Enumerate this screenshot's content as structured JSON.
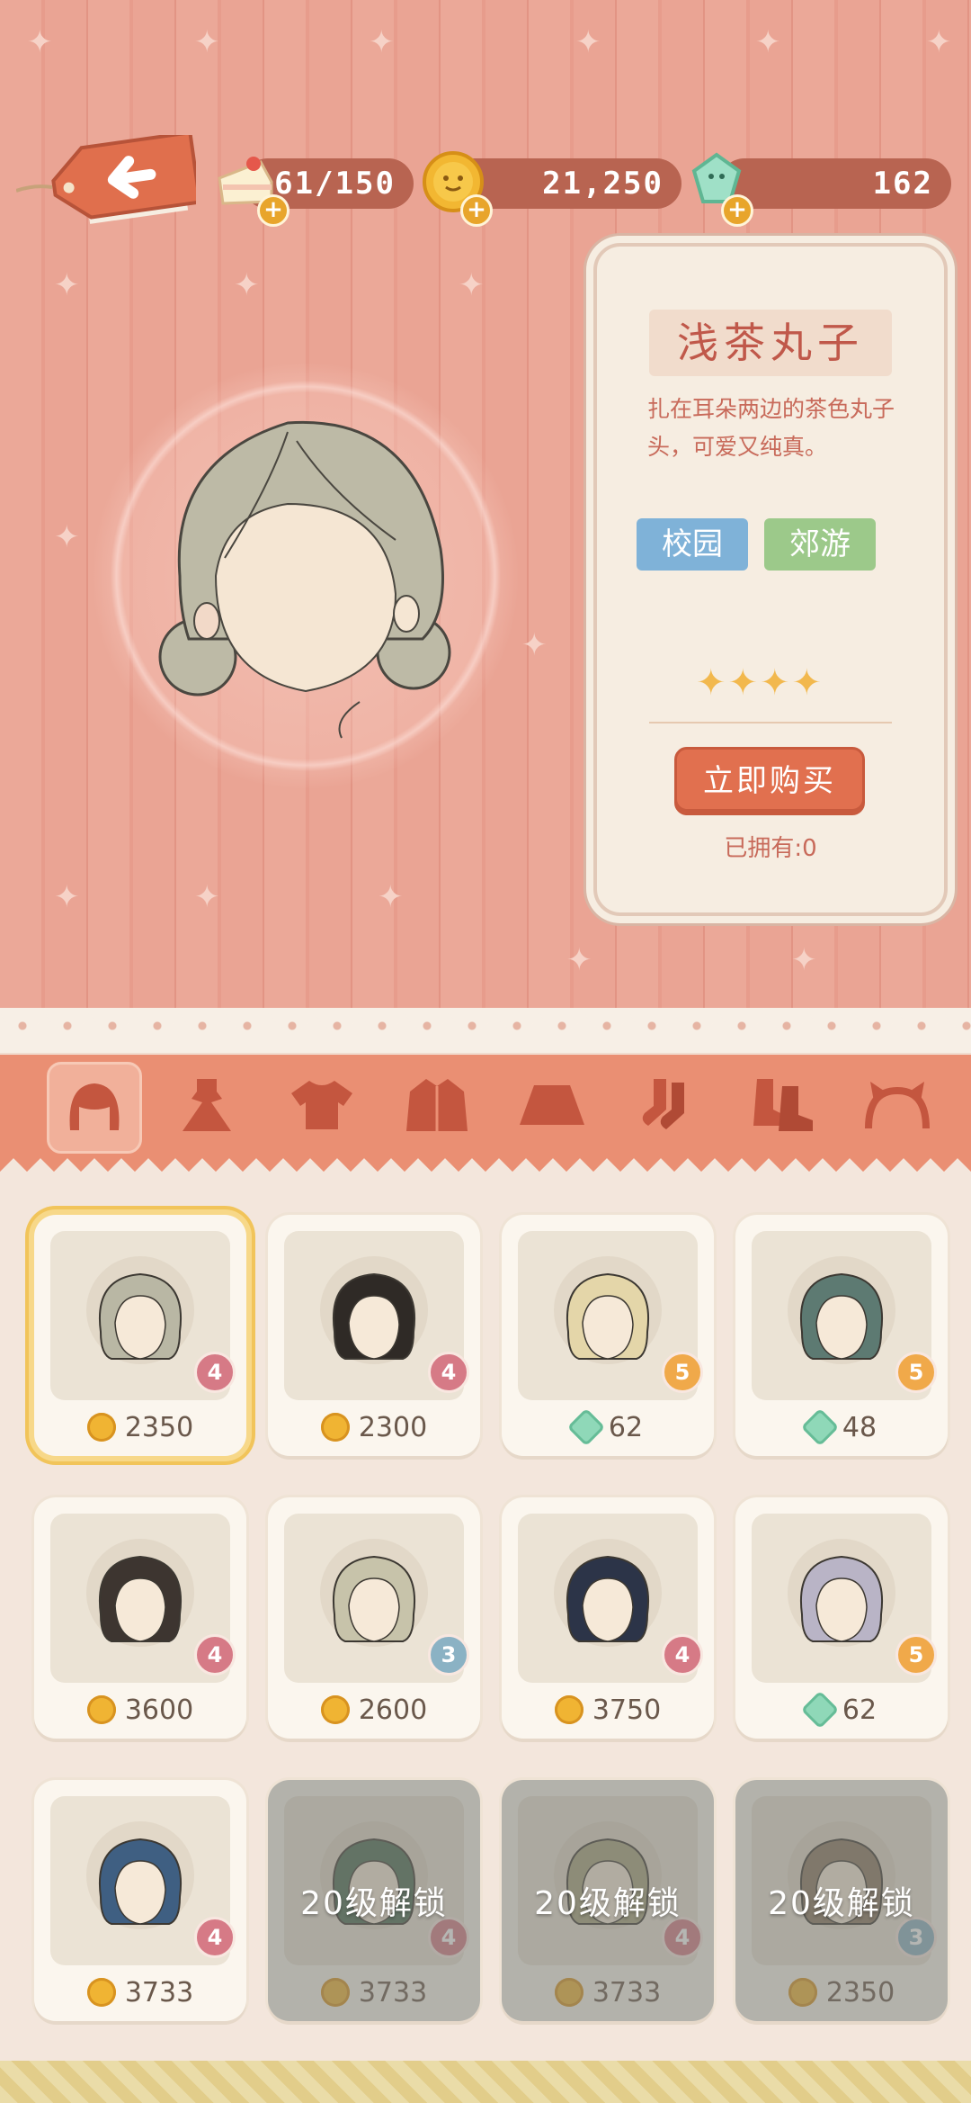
{
  "resources": {
    "stamina": "61/150",
    "coins": "21,250",
    "gems": "162"
  },
  "detail": {
    "name": "浅茶丸子",
    "description": "扎在耳朵两边的茶色丸子头，可爱又纯真。",
    "tags": [
      "校园",
      "郊游"
    ],
    "stars": "✦✦✦✦",
    "star_count": 4,
    "buy_label": "立即购买",
    "owned": "已拥有:0"
  },
  "categories": [
    "hair",
    "dress",
    "top",
    "coat",
    "skirt",
    "socks",
    "shoes",
    "accessory"
  ],
  "active_category": "hair",
  "items": [
    {
      "price": "2350",
      "currency": "coin",
      "rarity": "4",
      "hair_color": "#b9b7a4",
      "selected": true
    },
    {
      "price": "2300",
      "currency": "coin",
      "rarity": "4",
      "hair_color": "#2f2a26"
    },
    {
      "price": "62",
      "currency": "gem",
      "rarity": "5",
      "hair_color": "#e4d6a9"
    },
    {
      "price": "48",
      "currency": "gem",
      "rarity": "5",
      "hair_color": "#5d7a72"
    },
    {
      "price": "3600",
      "currency": "coin",
      "rarity": "4",
      "hair_color": "#3d3530"
    },
    {
      "price": "2600",
      "currency": "coin",
      "rarity": "3",
      "hair_color": "#c7c3aa"
    },
    {
      "price": "3750",
      "currency": "coin",
      "rarity": "4",
      "hair_color": "#2c3448"
    },
    {
      "price": "62",
      "currency": "gem",
      "rarity": "5",
      "hair_color": "#b9b4c6"
    },
    {
      "price": "3733",
      "currency": "coin",
      "rarity": "4",
      "hair_color": "#3f5f82"
    },
    {
      "price": "3733",
      "currency": "coin",
      "rarity": "4",
      "hair_color": "#4b6a52",
      "locked": true,
      "lock_label": "20级解锁"
    },
    {
      "price": "3733",
      "currency": "coin",
      "rarity": "4",
      "hair_color": "#a6a27d",
      "locked": true,
      "lock_label": "20级解锁"
    },
    {
      "price": "2350",
      "currency": "coin",
      "rarity": "3",
      "hair_color": "#8a7560",
      "locked": true,
      "lock_label": "20级解锁"
    }
  ],
  "colors": {
    "accent": "#e1704f",
    "wallpaper": "#eba898",
    "rarity_3": "#8bb2c4",
    "rarity_4": "#d67a86",
    "rarity_5": "#f0a94a"
  }
}
